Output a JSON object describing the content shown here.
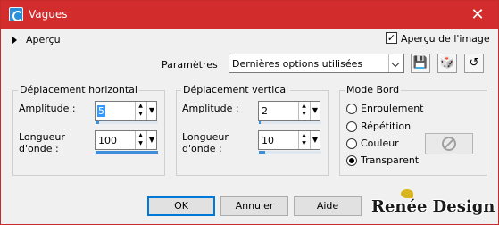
{
  "window": {
    "title": "Vagues",
    "close_glyph": "✕"
  },
  "apercu": {
    "label": "Aperçu"
  },
  "preview_check": {
    "label": "Aperçu de l'image",
    "checked": true,
    "check_glyph": "✓"
  },
  "params": {
    "label": "Paramètres",
    "selected": "Dernières options utilisées",
    "icons": [
      "save-icon",
      "dice-icon",
      "reset-icon"
    ],
    "icon_glyphs": [
      "💾",
      "🎲",
      "↺"
    ]
  },
  "horizontal": {
    "title": "Déplacement horizontal",
    "amplitude_label": "Amplitude :",
    "amplitude_value": "5",
    "wavelength_label_1": "Longueur",
    "wavelength_label_2": "d'onde :",
    "wavelength_value": "100",
    "amplitude_fill": 0.05,
    "wavelength_fill": 1.0
  },
  "vertical": {
    "title": "Déplacement vertical",
    "amplitude_label": "Amplitude :",
    "amplitude_value": "2",
    "wavelength_label_1": "Longueur",
    "wavelength_label_2": "d'onde :",
    "wavelength_value": "10",
    "amplitude_fill": 0.02,
    "wavelength_fill": 0.1
  },
  "mode_bord": {
    "title": "Mode Bord",
    "options": [
      "Enroulement",
      "Répétition",
      "Couleur",
      "Transparent"
    ],
    "selected": "Transparent"
  },
  "buttons": {
    "ok": "OK",
    "cancel": "Annuler",
    "help": "Aide"
  },
  "watermark": {
    "text": "Renée Design"
  },
  "colors": {
    "titlebar": "#d32c2c",
    "focus": "#0078d7",
    "spin_bar": "#3c8fd8"
  }
}
